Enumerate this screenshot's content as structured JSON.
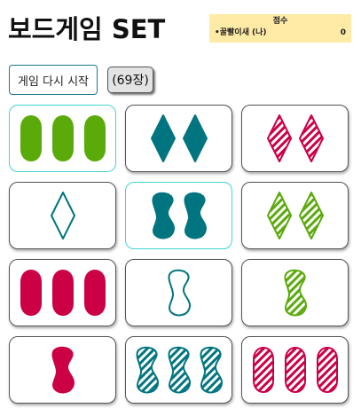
{
  "title": "보드게임 SET",
  "score": {
    "heading": "점수",
    "players": [
      {
        "name": "•꿀빨이새 (나)",
        "points": "0"
      }
    ]
  },
  "controls": {
    "restart_label": "게임 다시 시작",
    "deck_label": "(69장)"
  },
  "colors": {
    "green": "#5aaa0a",
    "teal": "#007580",
    "crimson": "#cc0044"
  },
  "cards": [
    {
      "count": 3,
      "shape": "oval",
      "color": "green",
      "fill": "solid",
      "selected": true
    },
    {
      "count": 2,
      "shape": "diamond",
      "color": "teal",
      "fill": "solid",
      "selected": false
    },
    {
      "count": 2,
      "shape": "diamond",
      "color": "crimson",
      "fill": "striped",
      "selected": false
    },
    {
      "count": 1,
      "shape": "diamond",
      "color": "teal",
      "fill": "open",
      "selected": false
    },
    {
      "count": 2,
      "shape": "squiggle",
      "color": "teal",
      "fill": "solid",
      "selected": true
    },
    {
      "count": 2,
      "shape": "diamond",
      "color": "green",
      "fill": "striped",
      "selected": false
    },
    {
      "count": 3,
      "shape": "oval",
      "color": "crimson",
      "fill": "solid",
      "selected": false
    },
    {
      "count": 1,
      "shape": "squiggle",
      "color": "teal",
      "fill": "open",
      "selected": false
    },
    {
      "count": 1,
      "shape": "squiggle",
      "color": "green",
      "fill": "striped",
      "selected": false
    },
    {
      "count": 1,
      "shape": "squiggle",
      "color": "crimson",
      "fill": "solid",
      "selected": false
    },
    {
      "count": 3,
      "shape": "squiggle",
      "color": "teal",
      "fill": "striped",
      "selected": false
    },
    {
      "count": 3,
      "shape": "oval",
      "color": "crimson",
      "fill": "striped",
      "selected": false
    }
  ]
}
